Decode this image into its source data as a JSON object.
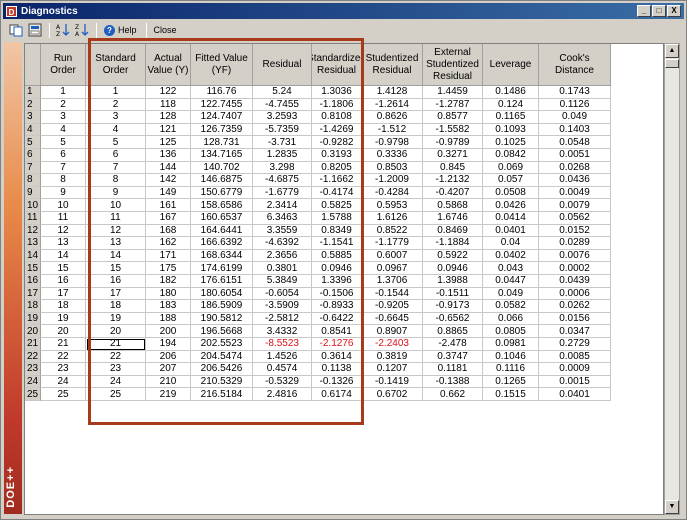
{
  "window": {
    "title": "Diagnostics",
    "app_icon_letter": "D",
    "controls": [
      "_",
      "□",
      "X"
    ]
  },
  "toolbar": {
    "copy_icon": "copy-icon",
    "export_icon": "export-icon",
    "sort_ascending_icon": "sort-ascending-icon",
    "sort_descending_icon": "sort-descending-icon",
    "help_label": "Help",
    "close_label": "Close"
  },
  "sidebar": {
    "logo": "DOE++"
  },
  "columns": [
    "",
    "Run Order",
    "Standard Order",
    "Actual Value (Y)",
    "Fitted Value (YF)",
    "Residual",
    "Standardized Residual",
    "Studentized Residual",
    "External Studentized Residual",
    "Leverage",
    "Cook's Distance"
  ],
  "rows": [
    [
      "1",
      "1",
      "1",
      "122",
      "116.76",
      "5.24",
      "1.3036",
      "1.4128",
      "1.4459",
      "0.1486",
      "0.1743"
    ],
    [
      "2",
      "2",
      "2",
      "118",
      "122.7455",
      "-4.7455",
      "-1.1806",
      "-1.2614",
      "-1.2787",
      "0.124",
      "0.1126"
    ],
    [
      "3",
      "3",
      "3",
      "128",
      "124.7407",
      "3.2593",
      "0.8108",
      "0.8626",
      "0.8577",
      "0.1165",
      "0.049"
    ],
    [
      "4",
      "4",
      "4",
      "121",
      "126.7359",
      "-5.7359",
      "-1.4269",
      "-1.512",
      "-1.5582",
      "0.1093",
      "0.1403"
    ],
    [
      "5",
      "5",
      "5",
      "125",
      "128.731",
      "-3.731",
      "-0.9282",
      "-0.9798",
      "-0.9789",
      "0.1025",
      "0.0548"
    ],
    [
      "6",
      "6",
      "6",
      "136",
      "134.7165",
      "1.2835",
      "0.3193",
      "0.3336",
      "0.3271",
      "0.0842",
      "0.0051"
    ],
    [
      "7",
      "7",
      "7",
      "144",
      "140.702",
      "3.298",
      "0.8205",
      "0.8503",
      "0.845",
      "0.069",
      "0.0268"
    ],
    [
      "8",
      "8",
      "8",
      "142",
      "146.6875",
      "-4.6875",
      "-1.1662",
      "-1.2009",
      "-1.2132",
      "0.057",
      "0.0436"
    ],
    [
      "9",
      "9",
      "9",
      "149",
      "150.6779",
      "-1.6779",
      "-0.4174",
      "-0.4284",
      "-0.4207",
      "0.0508",
      "0.0049"
    ],
    [
      "10",
      "10",
      "10",
      "161",
      "158.6586",
      "2.3414",
      "0.5825",
      "0.5953",
      "0.5868",
      "0.0426",
      "0.0079"
    ],
    [
      "11",
      "11",
      "11",
      "167",
      "160.6537",
      "6.3463",
      "1.5788",
      "1.6126",
      "1.6746",
      "0.0414",
      "0.0562"
    ],
    [
      "12",
      "12",
      "12",
      "168",
      "164.6441",
      "3.3559",
      "0.8349",
      "0.8522",
      "0.8469",
      "0.0401",
      "0.0152"
    ],
    [
      "13",
      "13",
      "13",
      "162",
      "166.6392",
      "-4.6392",
      "-1.1541",
      "-1.1779",
      "-1.1884",
      "0.04",
      "0.0289"
    ],
    [
      "14",
      "14",
      "14",
      "171",
      "168.6344",
      "2.3656",
      "0.5885",
      "0.6007",
      "0.5922",
      "0.0402",
      "0.0076"
    ],
    [
      "15",
      "15",
      "15",
      "175",
      "174.6199",
      "0.3801",
      "0.0946",
      "0.0967",
      "0.0946",
      "0.043",
      "0.0002"
    ],
    [
      "16",
      "16",
      "16",
      "182",
      "176.6151",
      "5.3849",
      "1.3396",
      "1.3706",
      "1.3988",
      "0.0447",
      "0.0439"
    ],
    [
      "17",
      "17",
      "17",
      "180",
      "180.6054",
      "-0.6054",
      "-0.1506",
      "-0.1544",
      "-0.1511",
      "0.049",
      "0.0006"
    ],
    [
      "18",
      "18",
      "18",
      "183",
      "186.5909",
      "-3.5909",
      "-0.8933",
      "-0.9205",
      "-0.9173",
      "0.0582",
      "0.0262"
    ],
    [
      "19",
      "19",
      "19",
      "188",
      "190.5812",
      "-2.5812",
      "-0.6422",
      "-0.6645",
      "-0.6562",
      "0.066",
      "0.0156"
    ],
    [
      "20",
      "20",
      "20",
      "200",
      "196.5668",
      "3.4332",
      "0.8541",
      "0.8907",
      "0.8865",
      "0.0805",
      "0.0347"
    ],
    [
      "21",
      "21",
      "21",
      "194",
      "202.5523",
      "-8.5523",
      "-2.1276",
      "-2.2403",
      "-2.478",
      "0.0981",
      "0.2729"
    ],
    [
      "22",
      "22",
      "22",
      "206",
      "204.5474",
      "1.4526",
      "0.3614",
      "0.3819",
      "0.3747",
      "0.1046",
      "0.0085"
    ],
    [
      "23",
      "23",
      "23",
      "207",
      "206.5426",
      "0.4574",
      "0.1138",
      "0.1207",
      "0.1181",
      "0.1116",
      "0.0009"
    ],
    [
      "24",
      "24",
      "24",
      "210",
      "210.5329",
      "-0.5329",
      "-0.1326",
      "-0.1419",
      "-0.1388",
      "0.1265",
      "0.0015"
    ],
    [
      "25",
      "25",
      "25",
      "219",
      "216.5184",
      "2.4816",
      "0.6174",
      "0.6702",
      "0.662",
      "0.1515",
      "0.0401"
    ]
  ],
  "highlight_row": 20,
  "highlight_cells": [
    5,
    6,
    7
  ],
  "selected_cell": [
    20,
    2
  ],
  "colors": {
    "title_gradient_start": "#0a246a",
    "title_gradient_end": "#3a6ea5",
    "highlight_box": "#a83a1c",
    "outlier_text": "#e0101a"
  }
}
